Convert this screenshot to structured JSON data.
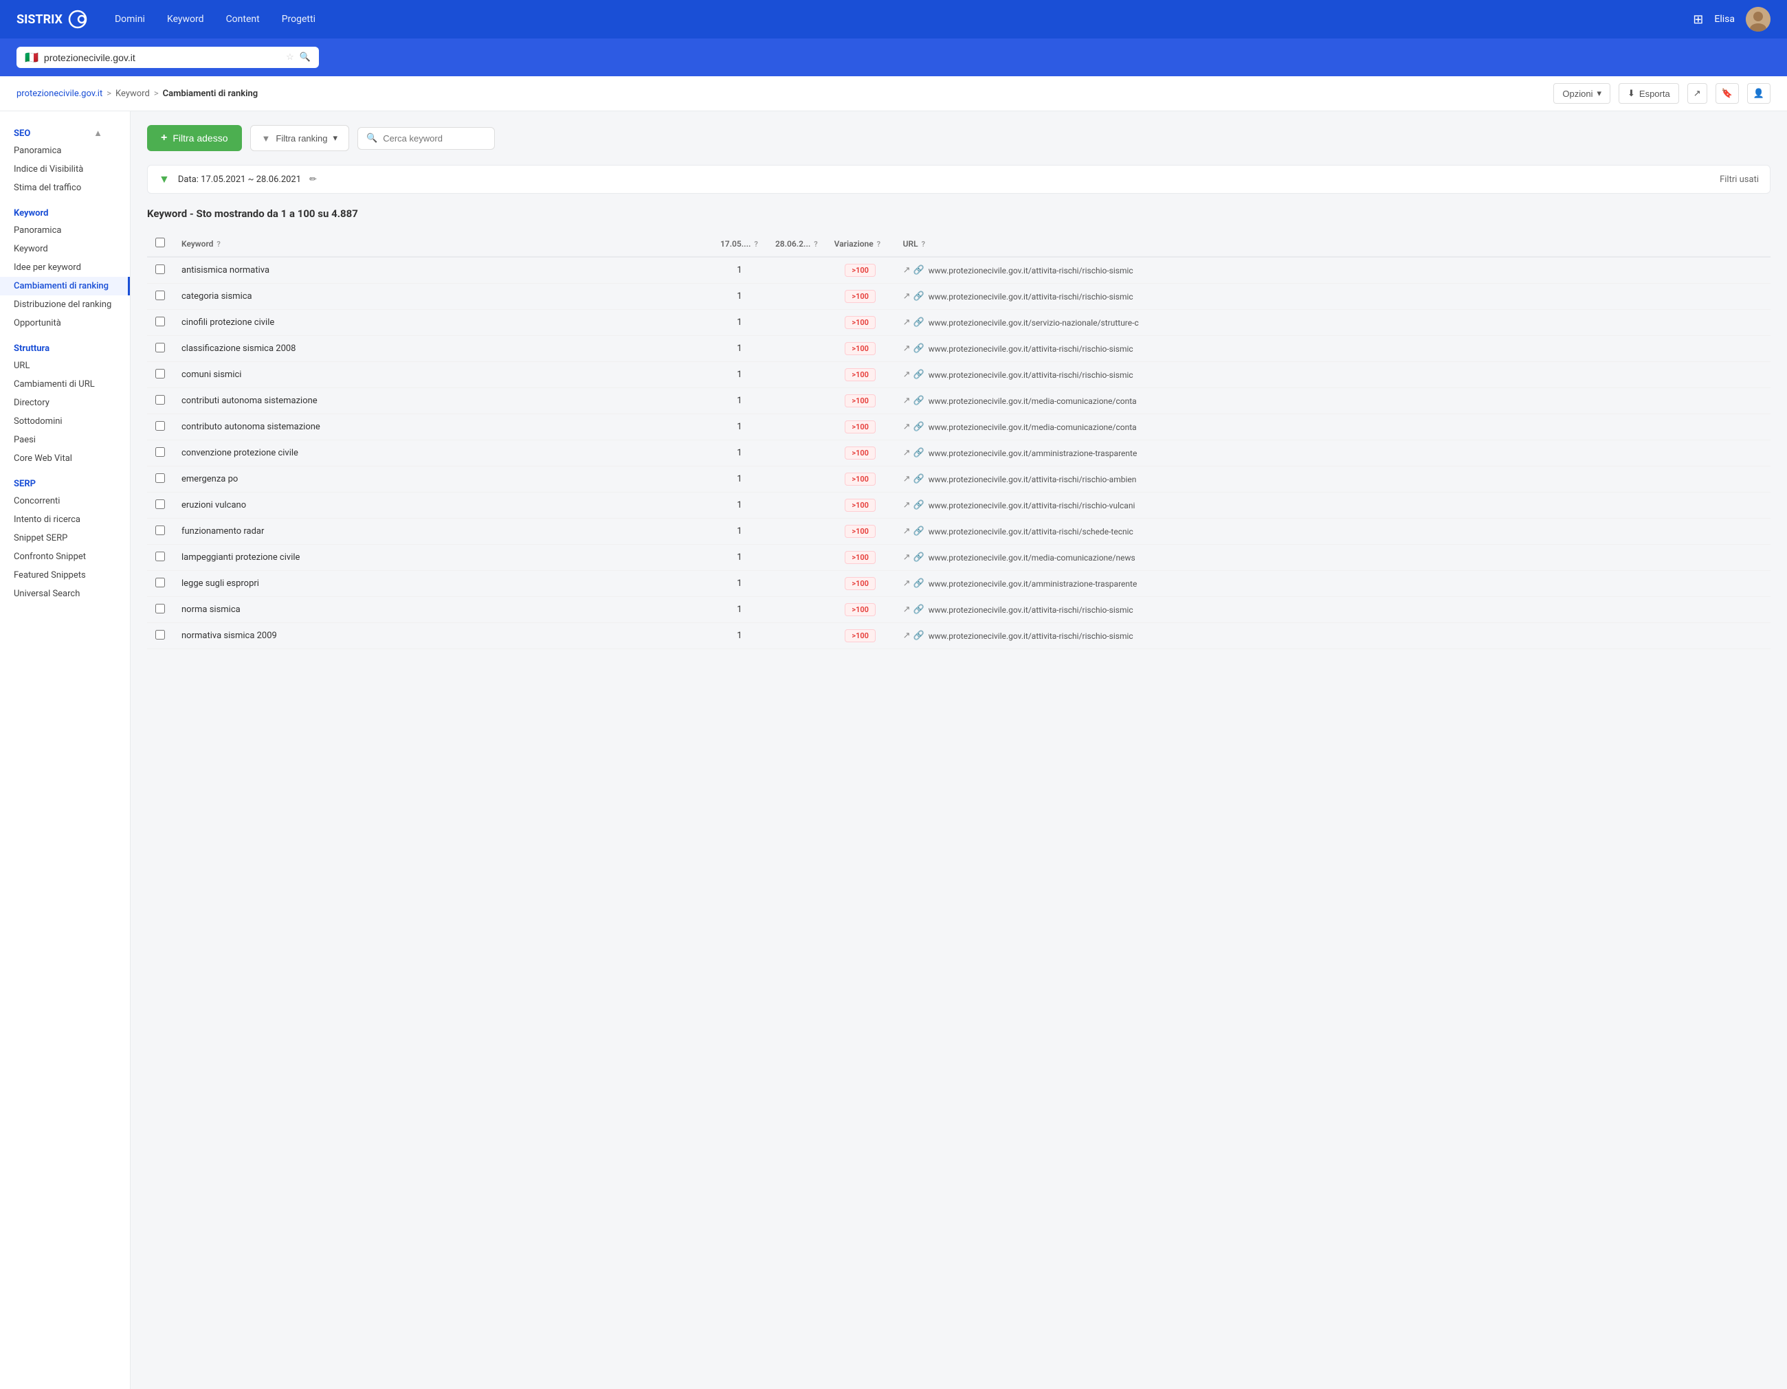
{
  "nav": {
    "logo": "SISTRIX",
    "items": [
      "Domini",
      "Keyword",
      "Content",
      "Progetti"
    ],
    "user": "Elisa"
  },
  "search": {
    "flag": "🇮🇹",
    "value": "protezionecivile.gov.it",
    "placeholder": "protezionecivile.gov.it"
  },
  "breadcrumb": {
    "root": "protezionecivile.gov.it",
    "sep1": ">",
    "middle": "Keyword",
    "sep2": ">",
    "current": "Cambiamenti di ranking",
    "options_label": "Opzioni",
    "export_label": "Esporta"
  },
  "sidebar": {
    "seo_label": "SEO",
    "seo_items": [
      "Panoramica",
      "Indice di Visibilità",
      "Stima del traffico"
    ],
    "keyword_label": "Keyword",
    "keyword_items": [
      "Panoramica",
      "Keyword",
      "Idee per keyword",
      "Cambiamenti di ranking",
      "Distribuzione del ranking",
      "Opportunità"
    ],
    "struttura_label": "Struttura",
    "struttura_items": [
      "URL",
      "Cambiamenti di URL",
      "Directory",
      "Sottodomini",
      "Paesi",
      "Core Web Vital"
    ],
    "serp_label": "SERP",
    "serp_items": [
      "Concorrenti",
      "Intento di ricerca",
      "Snippet SERP",
      "Confronto Snippet",
      "Featured Snippets",
      "Universal Search"
    ]
  },
  "filters": {
    "filter_adesso_label": "Filtra adesso",
    "filtra_ranking_label": "Filtra ranking",
    "cerca_keyword_placeholder": "Cerca keyword"
  },
  "date_filter": {
    "label": "Data: 17.05.2021 ~ 28.06.2021",
    "filtri_usati": "Filtri usati"
  },
  "table": {
    "title_prefix": "Keyword - Sto mostrando da 1 a 100 su 4.887",
    "col_keyword": "Keyword",
    "col_date1": "17.05....",
    "col_date2": "28.06.2...",
    "col_variation": "Variazione",
    "col_url": "URL",
    "rows": [
      {
        "keyword": "antisismica normativa",
        "date1": "1",
        "date2": "",
        "variation": ">100",
        "url": "www.protezionecivile.gov.it/attivita-rischi/rischio-sismic"
      },
      {
        "keyword": "categoria sismica",
        "date1": "1",
        "date2": "",
        "variation": ">100",
        "url": "www.protezionecivile.gov.it/attivita-rischi/rischio-sismic"
      },
      {
        "keyword": "cinofili protezione civile",
        "date1": "1",
        "date2": "",
        "variation": ">100",
        "url": "www.protezionecivile.gov.it/servizio-nazionale/strutture-c"
      },
      {
        "keyword": "classificazione sismica 2008",
        "date1": "1",
        "date2": "",
        "variation": ">100",
        "url": "www.protezionecivile.gov.it/attivita-rischi/rischio-sismic"
      },
      {
        "keyword": "comuni sismici",
        "date1": "1",
        "date2": "",
        "variation": ">100",
        "url": "www.protezionecivile.gov.it/attivita-rischi/rischio-sismic"
      },
      {
        "keyword": "contributi autonoma sistemazione",
        "date1": "1",
        "date2": "",
        "variation": ">100",
        "url": "www.protezionecivile.gov.it/media-comunicazione/conta"
      },
      {
        "keyword": "contributo autonoma sistemazione",
        "date1": "1",
        "date2": "",
        "variation": ">100",
        "url": "www.protezionecivile.gov.it/media-comunicazione/conta"
      },
      {
        "keyword": "convenzione protezione civile",
        "date1": "1",
        "date2": "",
        "variation": ">100",
        "url": "www.protezionecivile.gov.it/amministrazione-trasparente"
      },
      {
        "keyword": "emergenza po",
        "date1": "1",
        "date2": "",
        "variation": ">100",
        "url": "www.protezionecivile.gov.it/attivita-rischi/rischio-ambien"
      },
      {
        "keyword": "eruzioni vulcano",
        "date1": "1",
        "date2": "",
        "variation": ">100",
        "url": "www.protezionecivile.gov.it/attivita-rischi/rischio-vulcani"
      },
      {
        "keyword": "funzionamento radar",
        "date1": "1",
        "date2": "",
        "variation": ">100",
        "url": "www.protezionecivile.gov.it/attivita-rischi/schede-tecnic"
      },
      {
        "keyword": "lampeggianti protezione civile",
        "date1": "1",
        "date2": "",
        "variation": ">100",
        "url": "www.protezionecivile.gov.it/media-comunicazione/news"
      },
      {
        "keyword": "legge sugli espropri",
        "date1": "1",
        "date2": "",
        "variation": ">100",
        "url": "www.protezionecivile.gov.it/amministrazione-trasparente"
      },
      {
        "keyword": "norma sismica",
        "date1": "1",
        "date2": "",
        "variation": ">100",
        "url": "www.protezionecivile.gov.it/attivita-rischi/rischio-sismic"
      },
      {
        "keyword": "normativa sismica 2009",
        "date1": "1",
        "date2": "",
        "variation": ">100",
        "url": "www.protezionecivile.gov.it/attivita-rischi/rischio-sismic"
      }
    ]
  }
}
